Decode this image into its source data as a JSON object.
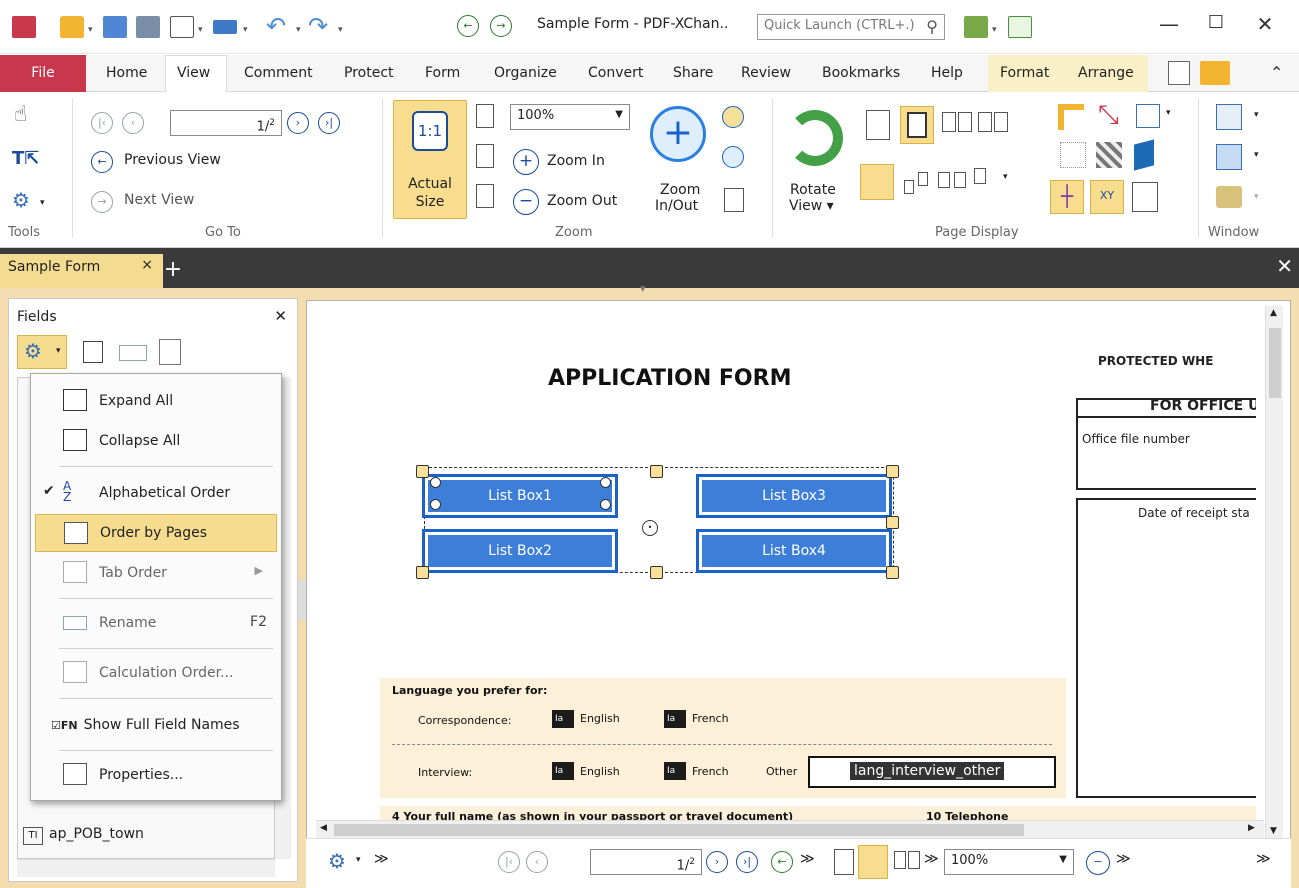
{
  "window": {
    "title": "Sample Form - PDF-XChan..",
    "quick_launch_placeholder": "Quick Launch (CTRL+.)"
  },
  "menu": {
    "file": "File",
    "tabs": [
      "Home",
      "View",
      "Comment",
      "Protect",
      "Form",
      "Organize",
      "Convert",
      "Share",
      "Review",
      "Bookmarks",
      "Help",
      "Format",
      "Arrange"
    ]
  },
  "ribbon": {
    "groups": {
      "tools": "Tools",
      "goto": "Go To",
      "zoom": "Zoom",
      "page_display": "Page Display",
      "window": "Window"
    },
    "page_value": "1/",
    "page_total": "2",
    "previous_view": "Previous View",
    "next_view": "Next View",
    "actual_size_line1": "Actual",
    "actual_size_line2": "Size",
    "zoom_value": "100%",
    "zoom_in": "Zoom In",
    "zoom_out": "Zoom Out",
    "zoom_inout_line1": "Zoom",
    "zoom_inout_line2": "In/Out",
    "rotate_line1": "Rotate",
    "rotate_line2": "View ▾"
  },
  "doc_tab": {
    "label": "Sample Form"
  },
  "fields_pane": {
    "title": "Fields",
    "tree_item": "ap_POB_town"
  },
  "dropdown": {
    "expand_all": "Expand All",
    "collapse_all": "Collapse All",
    "alphabetical_order": "Alphabetical Order",
    "order_by_pages": "Order by Pages",
    "tab_order": "Tab Order",
    "rename": "Rename",
    "rename_shortcut": "F2",
    "calculation_order": "Calculation Order...",
    "show_full_names": "Show Full Field Names",
    "show_full_names_prefix": "☑FN",
    "properties": "Properties..."
  },
  "document": {
    "heading": "APPLICATION FORM",
    "protected": "PROTECTED WHE",
    "office_use": "FOR OFFICE U",
    "office_file": "Office file number",
    "date_receipt": "Date of receipt sta",
    "list_boxes": [
      "List Box1",
      "List Box2",
      "List Box3",
      "List Box4"
    ],
    "language_label": "Language you prefer for:",
    "correspondence": "Correspondence:",
    "interview": "Interview:",
    "english": "English",
    "french": "French",
    "other": "Other",
    "other_field": "lang_interview_other",
    "next_line": "4   Your full name (as shown in your passport or travel document)",
    "next_right": "10   Telephone"
  },
  "statusbar": {
    "page_value": "1/",
    "page_total": "2",
    "zoom": "100%"
  },
  "colors": {
    "file_tab": "#c8374b",
    "accent": "#1a62c9",
    "highlight": "#f6dc8e",
    "pane_bg": "#f4deb0"
  }
}
